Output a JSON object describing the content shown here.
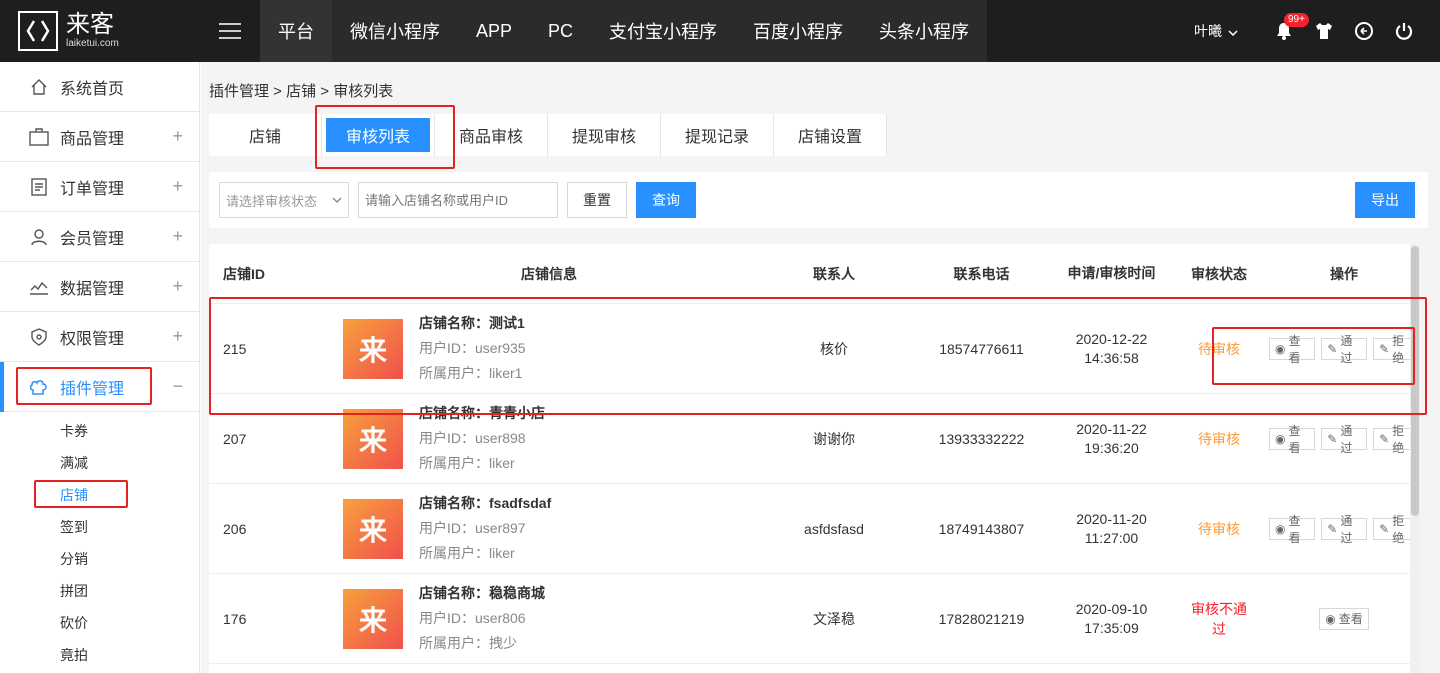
{
  "logo": {
    "name": "来客",
    "domain": "laiketui.com"
  },
  "nav": [
    "平台",
    "微信小程序",
    "APP",
    "PC",
    "支付宝小程序",
    "百度小程序",
    "头条小程序"
  ],
  "user": {
    "name": "叶曦",
    "badge": "99+"
  },
  "sidebar": {
    "items": [
      {
        "label": "系统首页",
        "icon": "home-icon"
      },
      {
        "label": "商品管理",
        "icon": "box-icon",
        "expand": "+"
      },
      {
        "label": "订单管理",
        "icon": "order-icon",
        "expand": "+"
      },
      {
        "label": "会员管理",
        "icon": "member-icon",
        "expand": "+"
      },
      {
        "label": "数据管理",
        "icon": "chart-icon",
        "expand": "+"
      },
      {
        "label": "权限管理",
        "icon": "shield-icon",
        "expand": "+"
      },
      {
        "label": "插件管理",
        "icon": "plugin-icon",
        "expand": "−"
      }
    ],
    "subitems": [
      "卡券",
      "满减",
      "店铺",
      "签到",
      "分销",
      "拼团",
      "砍价",
      "竟拍"
    ]
  },
  "breadcrumb": "插件管理 > 店铺 > 审核列表",
  "tabs": [
    "店铺",
    "审核列表",
    "商品审核",
    "提现审核",
    "提现记录",
    "店铺设置"
  ],
  "filter": {
    "status_placeholder": "请选择审核状态",
    "search_placeholder": "请输入店铺名称或用户ID",
    "reset": "重置",
    "query": "查询",
    "export": "导出"
  },
  "table": {
    "headers": [
      "店铺ID",
      "店铺信息",
      "联系人",
      "联系电话",
      "申请/审核时间",
      "审核状态",
      "操作"
    ],
    "ops": {
      "view": "查看",
      "pass": "通过",
      "reject": "拒绝"
    },
    "rows": [
      {
        "id": "215",
        "name": "店铺名称：测试1",
        "uid": "用户ID：user935",
        "owner": "所属用户：liker1",
        "contact": "核价",
        "phone": "18574776611",
        "date": "2020-12-22",
        "time": "14:36:58",
        "status": "待审核"
      },
      {
        "id": "207",
        "name": "店铺名称：青青小店",
        "uid": "用户ID：user898",
        "owner": "所属用户：liker",
        "contact": "谢谢你",
        "phone": "13933332222",
        "date": "2020-11-22",
        "time": "19:36:20",
        "status": "待审核"
      },
      {
        "id": "206",
        "name": "店铺名称：fsadfsdaf",
        "uid": "用户ID：user897",
        "owner": "所属用户：liker",
        "contact": "asfdsfasd",
        "phone": "18749143807",
        "date": "2020-11-20",
        "time": "11:27:00",
        "status": "待审核"
      },
      {
        "id": "176",
        "name": "店铺名称：稳稳商城",
        "uid": "用户ID：user806",
        "owner": "所属用户：拽少",
        "contact": "文泽稳",
        "phone": "17828021219",
        "date": "2020-09-10",
        "time": "17:35:09",
        "status": "审核不通过"
      }
    ]
  },
  "avatar_char": "来"
}
